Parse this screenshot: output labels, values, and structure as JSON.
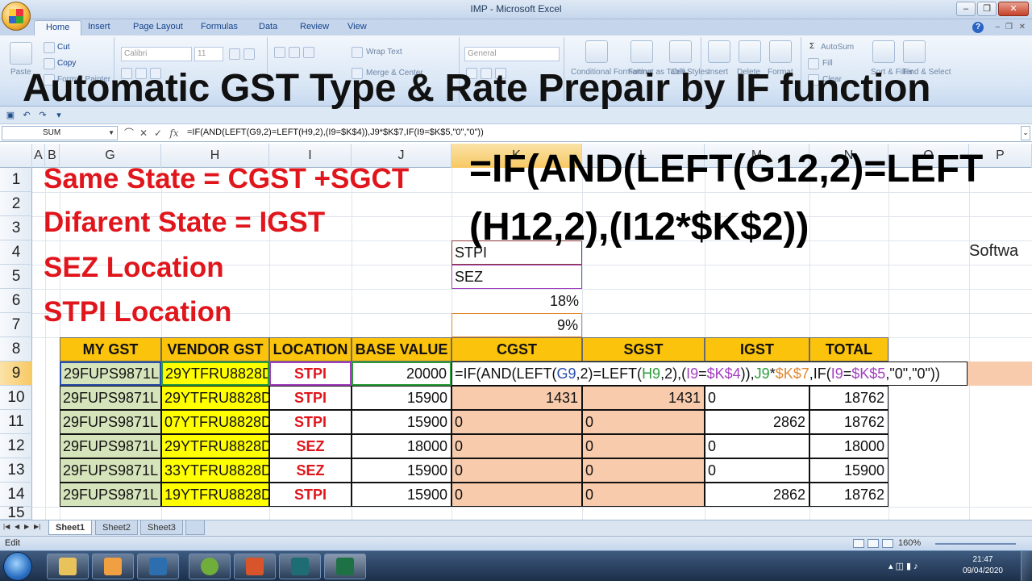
{
  "window": {
    "title": "IMP - Microsoft Excel"
  },
  "ribbon": {
    "tabs": [
      "Home",
      "Insert",
      "Page Layout",
      "Formulas",
      "Data",
      "Review",
      "View"
    ],
    "font_name": "Calibri",
    "font_size": "11",
    "number_format": "General",
    "labels": {
      "cut": "Cut",
      "copy": "Copy",
      "paste": "Paste",
      "format_painter": "Format Painter",
      "wrap_text": "Wrap Text",
      "merge_center": "Merge & Center",
      "conditional_formatting": "Conditional Formatting",
      "format_as_table": "Format as Table",
      "cell_styles": "Cell Styles",
      "insert": "Insert",
      "delete": "Delete",
      "format": "Format",
      "autosum": "AutoSum",
      "fill": "Fill",
      "clear": "Clear",
      "sort_filter": "Sort & Filter",
      "find_select": "Find & Select"
    }
  },
  "overlay_title": "Automatic GST Type & Rate Prepair by IF function",
  "formula_bar": {
    "name_box": "SUM",
    "formula": "=IF(AND(LEFT(G9,2)=LEFT(H9,2),(I9=$K$4)),J9*$K$7,IF(I9=$K$5,\"0\",\"0\"))"
  },
  "columns": [
    "A",
    "B",
    "G",
    "H",
    "I",
    "J",
    "K",
    "L",
    "M",
    "N",
    "O",
    "P"
  ],
  "rows": [
    "1",
    "2",
    "3",
    "4",
    "5",
    "6",
    "7",
    "8",
    "9",
    "10",
    "11",
    "12",
    "13",
    "14",
    "15"
  ],
  "notes": {
    "same_state": "Same State = CGST +SGCT",
    "different_state": "Difarent State = IGST",
    "sez": "SEZ Location",
    "stpi": "STPI Location"
  },
  "big_formula": {
    "line1": "=IF(AND(LEFT(G12,2)=LEFT",
    "line2": "(H12,2),(I12*$K$2))"
  },
  "lookup": {
    "k4": "STPI",
    "k5": "SEZ",
    "k6": "18%",
    "k7": "9%"
  },
  "side_text": "Softwa",
  "table": {
    "headers": [
      "MY GST",
      "VENDOR GST",
      "LOCATION",
      "BASE VALUE",
      "CGST",
      "SGST",
      "IGST",
      "TOTAL"
    ],
    "rows": [
      [
        "29FUPS9871L",
        "29YTFRU8828D",
        "STPI",
        "20000",
        "",
        "",
        "",
        ""
      ],
      [
        "29FUPS9871L",
        "29YTFRU8828D",
        "STPI",
        "15900",
        "1431",
        "1431",
        "0",
        "18762"
      ],
      [
        "29FUPS9871L",
        "07YTFRU8828D",
        "STPI",
        "15900",
        "0",
        "0",
        "2862",
        "18762"
      ],
      [
        "29FUPS9871L",
        "29YTFRU8828D",
        "SEZ",
        "18000",
        "0",
        "0",
        "0",
        "18000"
      ],
      [
        "29FUPS9871L",
        "33YTFRU8828D",
        "SEZ",
        "15900",
        "0",
        "0",
        "0",
        "15900"
      ],
      [
        "29FUPS9871L",
        "19YTFRU8828D",
        "STPI",
        "15900",
        "0",
        "0",
        "2862",
        "18762"
      ]
    ],
    "editing_formula": "=IF(AND(LEFT(G9,2)=LEFT(H9,2),(I9=$K$4)),J9*$K$7,IF(I9=$K$5,\"0\",\"0\"))"
  },
  "sheets": [
    "Sheet1",
    "Sheet2",
    "Sheet3"
  ],
  "status": {
    "mode": "Edit",
    "zoom": "160%"
  },
  "taskbar": {
    "time": "21:47",
    "date": "09/04/2020"
  },
  "colors": {
    "header_fill": "#fbc30b",
    "gst_fill": "#d6e4bc",
    "vendor_fill": "#ffff00",
    "tax_fill": "#f8cbad",
    "note_red": "#e0161c"
  }
}
